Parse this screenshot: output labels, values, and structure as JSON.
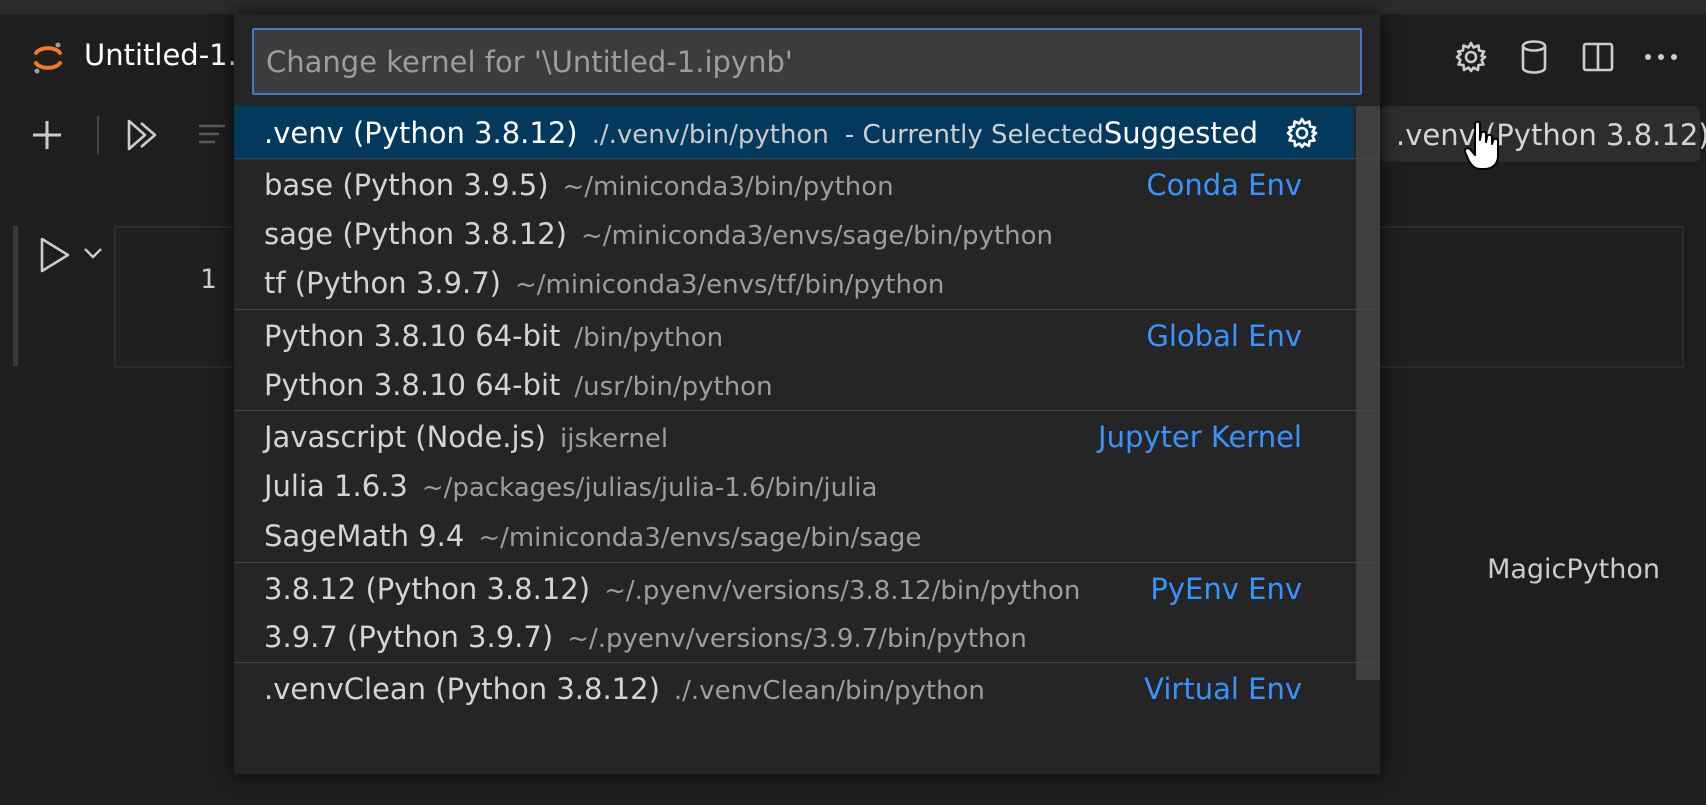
{
  "tab": {
    "title": "Untitled-1.",
    "icon": "jupyter-logo-icon"
  },
  "editor_actions": [
    "gear-icon",
    "database-icon",
    "split-editor-icon",
    "more-actions-icon"
  ],
  "notebook_toolbar": {
    "buttons": [
      "add-cell-icon",
      "run-all-icon",
      "clear-outputs-icon"
    ],
    "kernel_label": ".venv (Python 3.8.12)"
  },
  "cell": {
    "line_number": "1",
    "language": "MagicPython"
  },
  "quick_pick": {
    "placeholder": "Change kernel for '\\Untitled-1.ipynb'",
    "items": [
      {
        "label": ".venv (Python 3.8.12)",
        "description": "./.venv/bin/python",
        "detail": "- Currently Selected",
        "separator": "Suggested",
        "selected": true,
        "group_start": false,
        "has_gear": true
      },
      {
        "label": "base (Python 3.9.5)",
        "description": "~/miniconda3/bin/python",
        "separator": "Conda Env",
        "selected": false,
        "group_start": true
      },
      {
        "label": "sage (Python 3.8.12)",
        "description": "~/miniconda3/envs/sage/bin/python",
        "separator": "",
        "selected": false,
        "group_start": false
      },
      {
        "label": "tf (Python 3.9.7)",
        "description": "~/miniconda3/envs/tf/bin/python",
        "separator": "",
        "selected": false,
        "group_start": false
      },
      {
        "label": "Python 3.8.10 64-bit",
        "description": "/bin/python",
        "separator": "Global Env",
        "selected": false,
        "group_start": true
      },
      {
        "label": "Python 3.8.10 64-bit",
        "description": "/usr/bin/python",
        "separator": "",
        "selected": false,
        "group_start": false
      },
      {
        "label": "Javascript (Node.js)",
        "description": "ijskernel",
        "separator": "Jupyter Kernel",
        "selected": false,
        "group_start": true
      },
      {
        "label": "Julia 1.6.3",
        "description": "~/packages/julias/julia-1.6/bin/julia",
        "separator": "",
        "selected": false,
        "group_start": false
      },
      {
        "label": "SageMath 9.4",
        "description": "~/miniconda3/envs/sage/bin/sage",
        "separator": "",
        "selected": false,
        "group_start": false
      },
      {
        "label": "3.8.12 (Python 3.8.12)",
        "description": "~/.pyenv/versions/3.8.12/bin/python",
        "separator": "PyEnv Env",
        "selected": false,
        "group_start": true
      },
      {
        "label": "3.9.7 (Python 3.9.7)",
        "description": "~/.pyenv/versions/3.9.7/bin/python",
        "separator": "",
        "selected": false,
        "group_start": false
      },
      {
        "label": ".venvClean (Python 3.8.12)",
        "description": "./.venvClean/bin/python",
        "separator": "Virtual Env",
        "selected": false,
        "group_start": true
      }
    ]
  },
  "colors": {
    "accent_blue": "#3794ff",
    "selection_bg": "#04395e",
    "input_border": "#3f76d1",
    "jupyter_orange": "#f37726"
  }
}
